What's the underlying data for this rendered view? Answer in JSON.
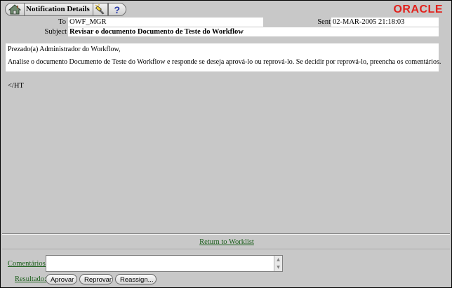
{
  "toolbar": {
    "title": "Notification Details",
    "help_glyph": "?",
    "icons": [
      "home-icon",
      "flashlight-icon",
      "help-icon"
    ]
  },
  "brand": {
    "logo_text": "ORACLE",
    "logo_color": "#e2211c"
  },
  "header": {
    "to_label": "To",
    "to_value": "OWF_MGR",
    "sent_label": "Sent",
    "sent_value": "02-MAR-2005 21:18:03",
    "subject_label": "Subject",
    "subject_value": "Revisar o documento Documento de Teste do Workflow"
  },
  "message": {
    "greeting": "Prezado(a) Administrador do Workflow,",
    "body": "Analise o documento Documento de Teste do Workflow e responde se deseja aprová-lo ou reprová-lo. Se decidir por reprová-lo, preencha os comentários.",
    "trailer": "</HT"
  },
  "links": {
    "return_to_worklist": "Return to Worklist"
  },
  "response": {
    "comments_label": "Comentários:",
    "comments_value": "",
    "result_label": "Resultado:",
    "buttons": {
      "approve": "Aprovar",
      "reject": "Reprovar",
      "reassign": "Reassign..."
    }
  },
  "colors": {
    "background": "#c8c8c8",
    "link": "#1a5e1a",
    "help": "#2a3aa8"
  }
}
